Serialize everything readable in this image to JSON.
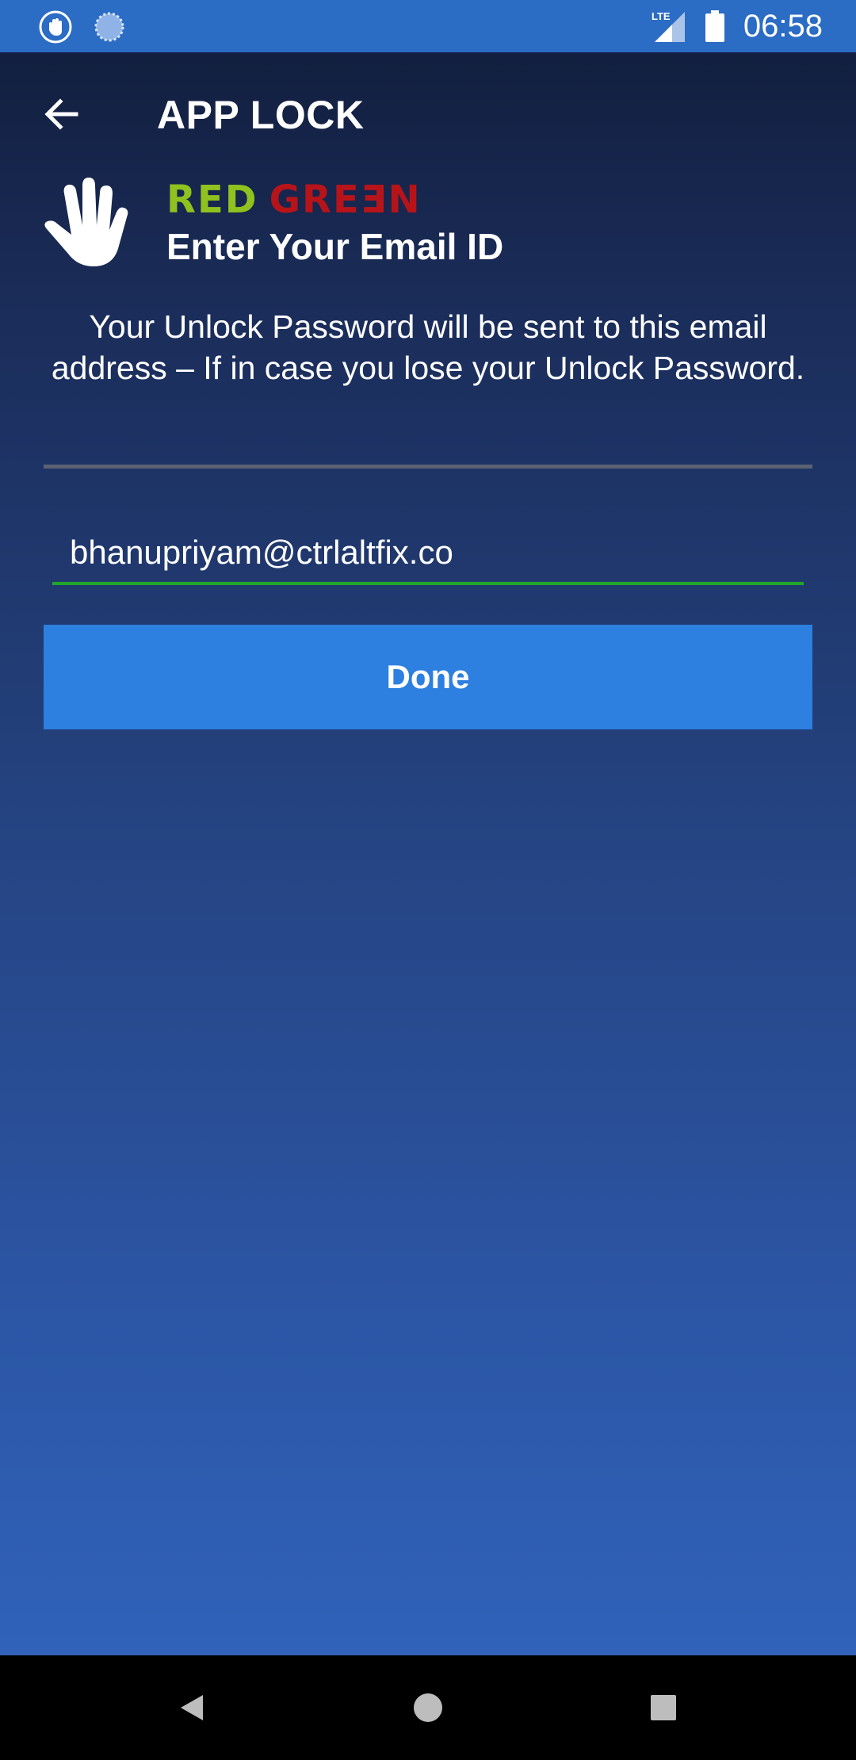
{
  "status_bar": {
    "time": "06:58",
    "network": "LTE",
    "left_icons": [
      "hand-icon",
      "loading-icon"
    ],
    "right_icons": [
      "signal-icon",
      "battery-icon"
    ]
  },
  "app_bar": {
    "title": "APP LOCK",
    "back_icon": "back-arrow-icon"
  },
  "header": {
    "brand_part1": "RED",
    "brand_part2": "GREƎN",
    "title": "Enter Your Email ID",
    "icon": "hand-icon"
  },
  "info_text": "Your Unlock Password will be sent to this email address – If in case you lose your Unlock Password.",
  "email_input": {
    "value": "bhanupriyam@ctrlaltfix.co"
  },
  "done_button": {
    "label": "Done"
  },
  "nav_bar": {
    "icons": [
      "back-triangle-icon",
      "home-circle-icon",
      "recents-square-icon"
    ]
  },
  "colors": {
    "status_bar": "#2b6cc4",
    "button": "#2d7fe0",
    "input_underline": "#22a52b",
    "brand_red_text": "#8fc21f",
    "brand_green_text": "#b7141a"
  }
}
